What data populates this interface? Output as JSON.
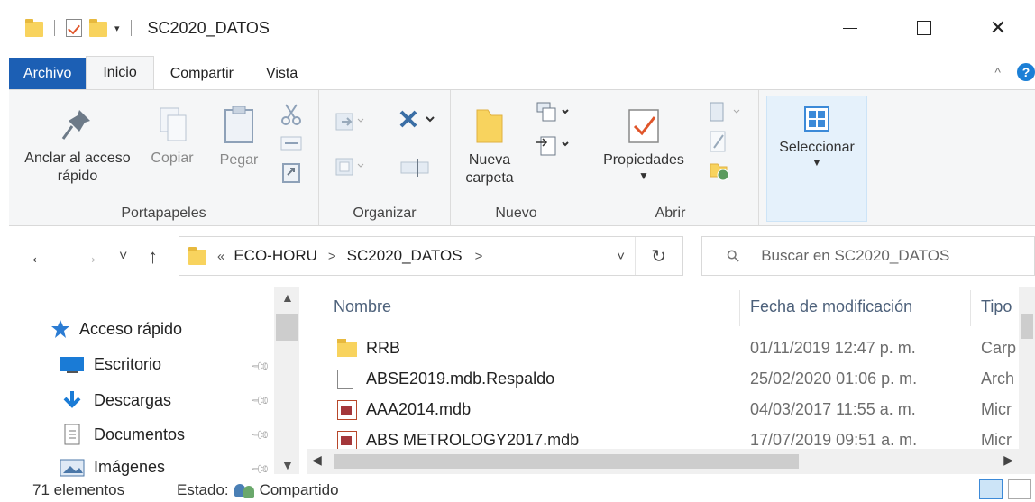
{
  "window": {
    "title": "SC2020_DATOS",
    "minimize": "—",
    "maximize": "☐",
    "close": "✕",
    "qa_dropdown": "▾"
  },
  "ribbon": {
    "tabs": [
      "Archivo",
      "Inicio",
      "Compartir",
      "Vista"
    ],
    "active_tab": "Inicio",
    "collapse": "^",
    "help": "?",
    "groups": {
      "portapapeles": {
        "label": "Portapapeles",
        "anclar": "Anclar al acceso rápido",
        "copiar": "Copiar",
        "pegar": "Pegar"
      },
      "organizar": {
        "label": "Organizar"
      },
      "nuevo": {
        "label": "Nuevo",
        "nueva_carpeta": "Nueva carpeta"
      },
      "abrir": {
        "label": "Abrir",
        "propiedades": "Propiedades"
      },
      "seleccionar": {
        "label": "Seleccionar"
      }
    }
  },
  "nav": {
    "back": "←",
    "forward": "→",
    "recent": "˅",
    "up": "↑",
    "breadcrumb": [
      "«",
      "ECO-HORU",
      ">",
      "SC2020_DATOS",
      ">"
    ],
    "address_dropdown": "˅",
    "refresh": "↻",
    "search_placeholder": "Buscar en SC2020_DATOS"
  },
  "navpane": {
    "items": [
      {
        "label": "Acceso rápido",
        "pinned": false
      },
      {
        "label": "Escritorio",
        "pinned": true
      },
      {
        "label": "Descargas",
        "pinned": true
      },
      {
        "label": "Documentos",
        "pinned": true
      },
      {
        "label": "Imágenes",
        "pinned": true
      }
    ]
  },
  "filelist": {
    "columns": [
      "Nombre",
      "Fecha de modificación",
      "Tipo"
    ],
    "rows": [
      {
        "name": "RRB",
        "date": "01/11/2019 12:47 p. m.",
        "type": "Carp",
        "icon": "folder-icon"
      },
      {
        "name": "ABSE2019.mdb.Respaldo",
        "date": "25/02/2020 01:06 p. m.",
        "type": "Arch",
        "icon": "document-icon"
      },
      {
        "name": "AAA2014.mdb",
        "date": "04/03/2017 11:55 a. m.",
        "type": "Micr",
        "icon": "access-db-icon"
      },
      {
        "name": "ABS METROLOGY2017.mdb",
        "date": "17/07/2019 09:51 a. m.",
        "type": "Micr",
        "icon": "access-db-icon"
      }
    ]
  },
  "status": {
    "count": "71 elementos",
    "state_label": "Estado:",
    "state_value": "Compartido"
  },
  "colors": {
    "accent": "#1c5fb4",
    "folder": "#f8d35e",
    "ribbon_bg": "#f5f6f7",
    "selected_bg": "#e5f1fb"
  }
}
